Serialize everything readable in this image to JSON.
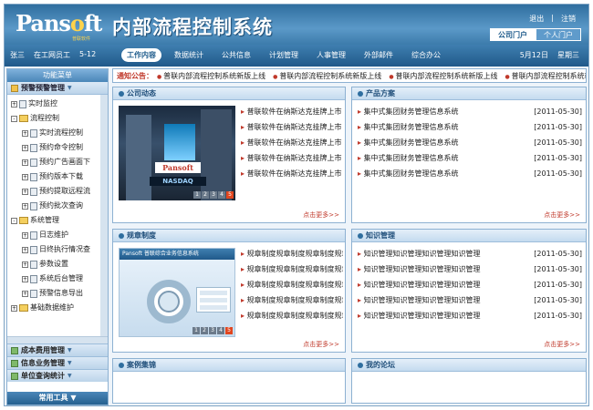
{
  "header": {
    "logo_main_a": "Pans",
    "logo_main_o": "o",
    "logo_main_b": "ft",
    "logo_sub": "普联软件",
    "title": "内部流程控制系统",
    "links": [
      "退出",
      "|",
      "注销"
    ],
    "portal_tabs": [
      "公司门户",
      "个人门户"
    ]
  },
  "nav": {
    "user": [
      "张三",
      "在工网员工",
      "5-12"
    ],
    "tabs": [
      "工作内容",
      "数据统计",
      "公共信息",
      "计划管理",
      "人事管理",
      "外部邮件",
      "综合办公"
    ],
    "date": "5月12日",
    "weekday": "星期三"
  },
  "sidebar": {
    "title": "功能菜单",
    "top_menu": "预警预警管理",
    "tree": [
      {
        "label": "实时监控",
        "level": 1
      },
      {
        "label": "流程控制",
        "level": 1
      },
      {
        "label": "实时流程控制",
        "level": 2
      },
      {
        "label": "预约命令控制",
        "level": 2
      },
      {
        "label": "预约广告画面下",
        "level": 2
      },
      {
        "label": "预约版本下载",
        "level": 2
      },
      {
        "label": "预约提取远程流",
        "level": 2
      },
      {
        "label": "预约批次查询",
        "level": 2
      },
      {
        "label": "系统管理",
        "level": 1
      },
      {
        "label": "日志维护",
        "level": 2
      },
      {
        "label": "日终执行情况查",
        "level": 2
      },
      {
        "label": "参数设置",
        "level": 2
      },
      {
        "label": "系统后台管理",
        "level": 2
      },
      {
        "label": "预警信息导出",
        "level": 2
      },
      {
        "label": "基础数据维护",
        "level": 1
      }
    ],
    "bottom_menus": [
      "成本费用管理",
      "信息业务管理",
      "单位查询统计"
    ],
    "tools": "常用工具"
  },
  "notice": {
    "label": "通知公告：",
    "items": [
      "普联内部流程控制系统新版上线",
      "普联内部流程控制系统新版上线",
      "普联内部流程控制系统新版上线",
      "普联内部流程控制系统新版"
    ]
  },
  "panels": {
    "company_news": {
      "title": "公司动态",
      "items": [
        "普联软件在纳斯达克挂牌上市",
        "普联软件在纳斯达克挂牌上市",
        "普联软件在纳斯达克挂牌上市",
        "普联软件在纳斯达克挂牌上市",
        "普联软件在纳斯达克挂牌上市"
      ],
      "photo_brand": "Pansoft",
      "photo_sign": "NASDAQ",
      "pager": [
        "1",
        "2",
        "3",
        "4",
        "5"
      ],
      "more": "点击更多>>"
    },
    "products": {
      "title": "产品方案",
      "items": [
        {
          "text": "集中式集团财务管理信息系统",
          "date": "[2011-05-30]"
        },
        {
          "text": "集中式集团财务管理信息系统",
          "date": "[2011-05-30]"
        },
        {
          "text": "集中式集团财务管理信息系统",
          "date": "[2011-05-30]"
        },
        {
          "text": "集中式集团财务管理信息系统",
          "date": "[2011-05-30]"
        },
        {
          "text": "集中式集团财务管理信息系统",
          "date": "[2011-05-30]"
        }
      ],
      "more": "点击更多>>"
    },
    "regulations": {
      "title": "规章制度",
      "items": [
        "规章制度规章制度规章制度规章制度",
        "规章制度规章制度规章制度规章制度",
        "规章制度规章制度规章制度规章制度",
        "规章制度规章制度规章制度规章制度",
        "规章制度规章制度规章制度规章制度"
      ],
      "screen_title": "Pansoft 普联综合业务信息系统",
      "pager": [
        "1",
        "2",
        "3",
        "4",
        "5"
      ],
      "more": "点击更多>>"
    },
    "knowledge": {
      "title": "知识管理",
      "items": [
        {
          "text": "知识管理知识管理知识管理知识管理",
          "date": "[2011-05-30]"
        },
        {
          "text": "知识管理知识管理知识管理知识管理",
          "date": "[2011-05-30]"
        },
        {
          "text": "知识管理知识管理知识管理知识管理",
          "date": "[2011-05-30]"
        },
        {
          "text": "知识管理知识管理知识管理知识管理",
          "date": "[2011-05-30]"
        },
        {
          "text": "知识管理知识管理知识管理知识管理",
          "date": "[2011-05-30]"
        }
      ],
      "more": "点击更多>>"
    },
    "cases": {
      "title": "案例集锦"
    },
    "forum": {
      "title": "我的论坛"
    }
  },
  "colors": {
    "header": "#2f6e9f",
    "accent": "#c0392b",
    "border": "#8db1d2"
  }
}
